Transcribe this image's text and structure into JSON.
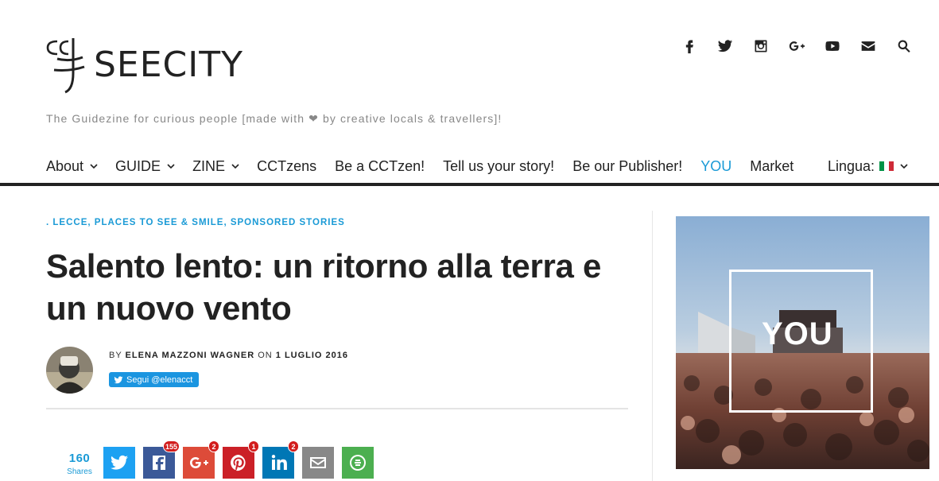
{
  "brand": {
    "logo_text": "SEECITY",
    "logo_mark": "cc",
    "tagline_before": "The Guidezine for curious people [made with",
    "tagline_after": "by creative locals & travellers]!"
  },
  "social_icons": [
    "facebook-icon",
    "twitter-icon",
    "instagram-icon",
    "google-plus-icon",
    "youtube-icon",
    "mail-icon",
    "search-icon"
  ],
  "nav": {
    "items": [
      {
        "label": "About",
        "dropdown": true
      },
      {
        "label": "GUIDE",
        "dropdown": true
      },
      {
        "label": "ZINE",
        "dropdown": true
      },
      {
        "label": "CCTzens",
        "dropdown": false
      },
      {
        "label": "Be a CCTzen!",
        "dropdown": false
      },
      {
        "label": "Tell us your story!",
        "dropdown": false
      },
      {
        "label": "Be our Publisher!",
        "dropdown": false
      },
      {
        "label": "YOU",
        "dropdown": false
      },
      {
        "label": "Market",
        "dropdown": false
      }
    ],
    "language_label": "Lingua:",
    "colors": {
      "accent": "#1a9ad6",
      "text": "#222222"
    }
  },
  "article": {
    "categories_prefix": ".",
    "categories": [
      "LECCE",
      "PLACES TO SEE & SMILE",
      "SPONSORED STORIES"
    ],
    "title": "Salento lento: un ritorno alla terra e un nuovo vento",
    "by_label": "BY",
    "author": "ELENA MAZZONI WAGNER",
    "on_label": "ON",
    "date": "1 LUGLIO 2016",
    "follow_label": "Segui @elenacct"
  },
  "share": {
    "count": "160",
    "count_label": "Shares",
    "buttons": [
      {
        "name": "twitter",
        "badge": ""
      },
      {
        "name": "facebook",
        "badge": "155"
      },
      {
        "name": "google-plus",
        "badge": "2"
      },
      {
        "name": "pinterest",
        "badge": "1"
      },
      {
        "name": "linkedin",
        "badge": "2"
      },
      {
        "name": "email",
        "badge": ""
      },
      {
        "name": "more",
        "badge": ""
      }
    ]
  },
  "sidebar": {
    "banner_text": "YOU"
  }
}
